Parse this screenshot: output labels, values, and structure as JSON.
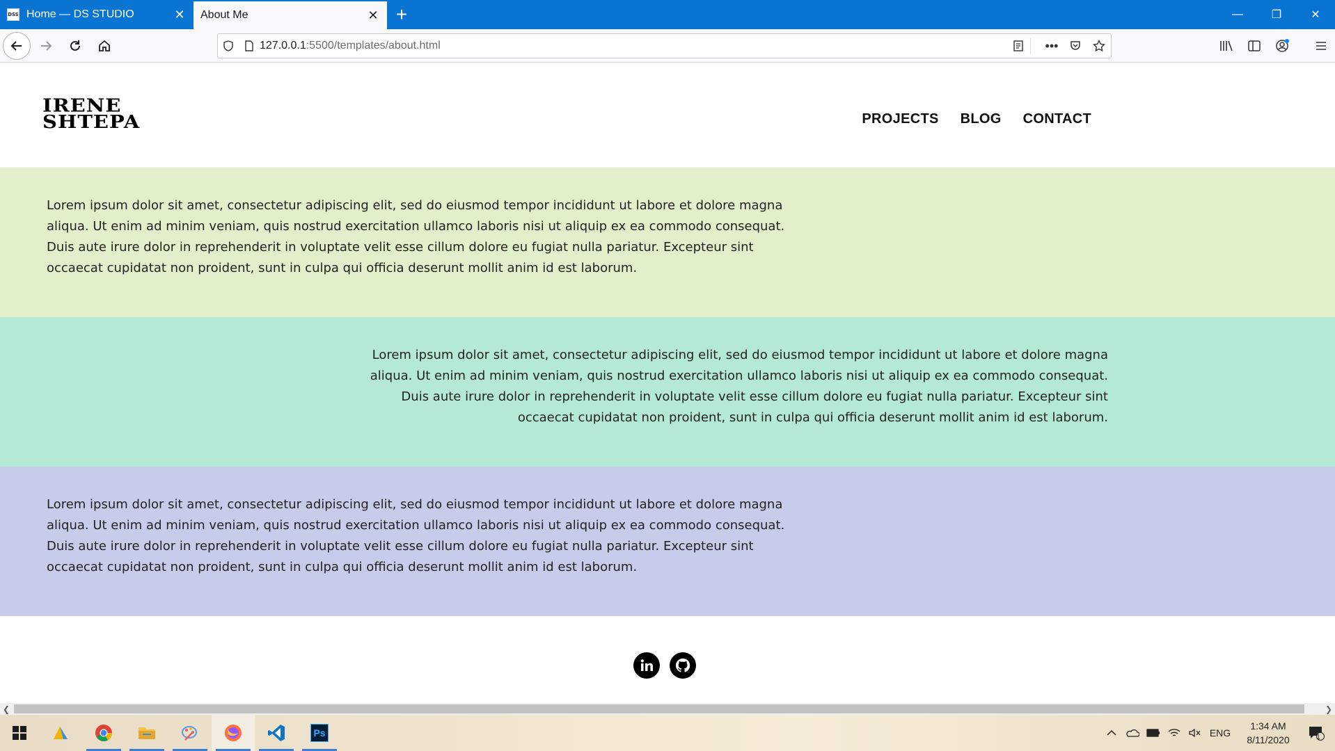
{
  "browser": {
    "tabs": [
      {
        "title": "Home — DS STUDIO",
        "favicon_text": "DSS",
        "active": false
      },
      {
        "title": "About Me",
        "active": true
      }
    ],
    "url": {
      "host": "127.0.0.1",
      "path": ":5500/templates/about.html"
    }
  },
  "site": {
    "logo_line1": "IRENE",
    "logo_line2": "SHTEPA",
    "nav": [
      "PROJECTS",
      "BLOG",
      "CONTACT"
    ],
    "sections": [
      {
        "bg": "#e2efcb",
        "align": "left",
        "text": "Lorem ipsum dolor sit amet, consectetur adipiscing elit, sed do eiusmod tempor incididunt ut labore et dolore magna aliqua. Ut enim ad minim veniam, quis nostrud exercitation ullamco laboris nisi ut aliquip ex ea commodo consequat. Duis aute irure dolor in reprehenderit in voluptate velit esse cillum dolore eu fugiat nulla pariatur. Excepteur sint occaecat cupidatat non proident, sunt in culpa qui officia deserunt mollit anim id est laborum."
      },
      {
        "bg": "#b4e9d5",
        "align": "right",
        "text": "Lorem ipsum dolor sit amet, consectetur adipiscing elit, sed do eiusmod tempor incididunt ut labore et dolore magna aliqua. Ut enim ad minim veniam, quis nostrud exercitation ullamco laboris nisi ut aliquip ex ea commodo consequat. Duis aute irure dolor in reprehenderit in voluptate velit esse cillum dolore eu fugiat nulla pariatur. Excepteur sint occaecat cupidatat non proident, sunt in culpa qui officia deserunt mollit anim id est laborum."
      },
      {
        "bg": "#c6cce9",
        "align": "left",
        "text": "Lorem ipsum dolor sit amet, consectetur adipiscing elit, sed do eiusmod tempor incididunt ut labore et dolore magna aliqua. Ut enim ad minim veniam, quis nostrud exercitation ullamco laboris nisi ut aliquip ex ea commodo consequat. Duis aute irure dolor in reprehenderit in voluptate velit esse cillum dolore eu fugiat nulla pariatur. Excepteur sint occaecat cupidatat non proident, sunt in culpa qui officia deserunt mollit anim id est laborum."
      }
    ],
    "social_icons": [
      "linkedin-icon",
      "github-icon"
    ]
  },
  "taskbar": {
    "apps": [
      "file-explorer-icon",
      "chrome-icon",
      "folder-icon",
      "paint-icon",
      "firefox-icon",
      "vscode-icon",
      "photoshop-icon"
    ],
    "photoshop_label": "Ps",
    "language": "ENG",
    "time": "1:34 AM",
    "date": "8/11/2020",
    "notification_count": "1"
  },
  "colors": {
    "titlebar": "#0a74d2",
    "accent": "#3b7fd2"
  }
}
